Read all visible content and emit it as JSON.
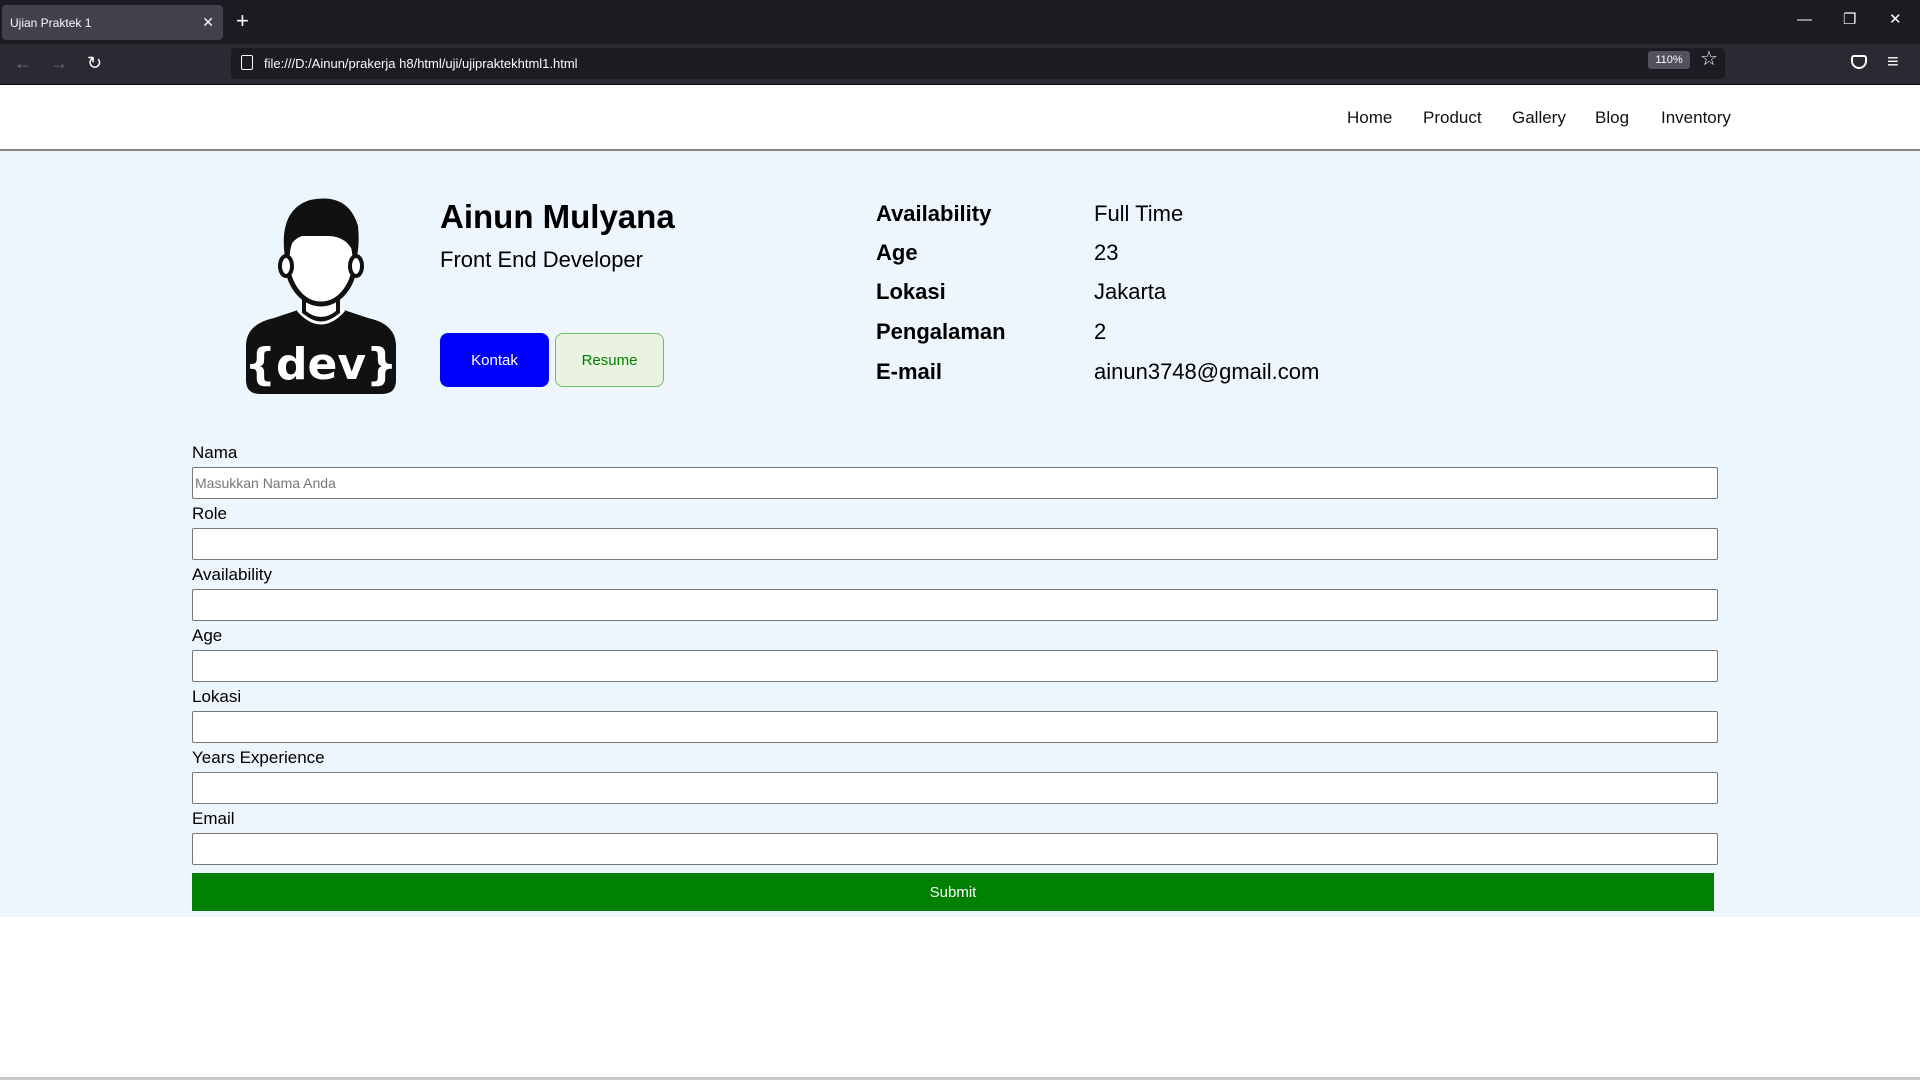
{
  "browser": {
    "tab_title": "Ujian Praktek 1",
    "tab_close": "✕",
    "new_tab": "+",
    "url": "file:///D:/Ainun/prakerja h8/html/uji/ujipraktekhtml1.html",
    "zoom": "110%",
    "icons": {
      "back": "←",
      "forward": "→",
      "reload": "↻",
      "star": "☆",
      "menu": "≡",
      "minimize": "—",
      "restore": "❐",
      "close": "✕"
    }
  },
  "nav": {
    "links": [
      "Home",
      "Product",
      "Gallery",
      "Blog",
      "Inventory"
    ]
  },
  "profile": {
    "name": "Ainun Mulyana",
    "role": "Front End Developer",
    "avatar_text": "{dev}",
    "buttons": {
      "kontak": "Kontak",
      "resume": "Resume"
    }
  },
  "info": [
    {
      "label": "Availability",
      "value": "Full Time"
    },
    {
      "label": "Age",
      "value": "23"
    },
    {
      "label": "Lokasi",
      "value": "Jakarta"
    },
    {
      "label": "Pengalaman",
      "value": "2"
    },
    {
      "label": "E-mail",
      "value": "ainun3748@gmail.com"
    }
  ],
  "form": {
    "fields": [
      {
        "label": "Nama",
        "placeholder": "Masukkan Nama Anda"
      },
      {
        "label": "Role",
        "placeholder": ""
      },
      {
        "label": "Availability",
        "placeholder": ""
      },
      {
        "label": "Age",
        "placeholder": ""
      },
      {
        "label": "Lokasi",
        "placeholder": ""
      },
      {
        "label": "Years Experience",
        "placeholder": ""
      },
      {
        "label": "Email",
        "placeholder": ""
      }
    ],
    "submit": "Submit"
  },
  "colors": {
    "kontak_bg": "#0000ff",
    "resume_text": "#008000",
    "submit_bg": "#008000",
    "content_bg": "#eef6fd"
  }
}
